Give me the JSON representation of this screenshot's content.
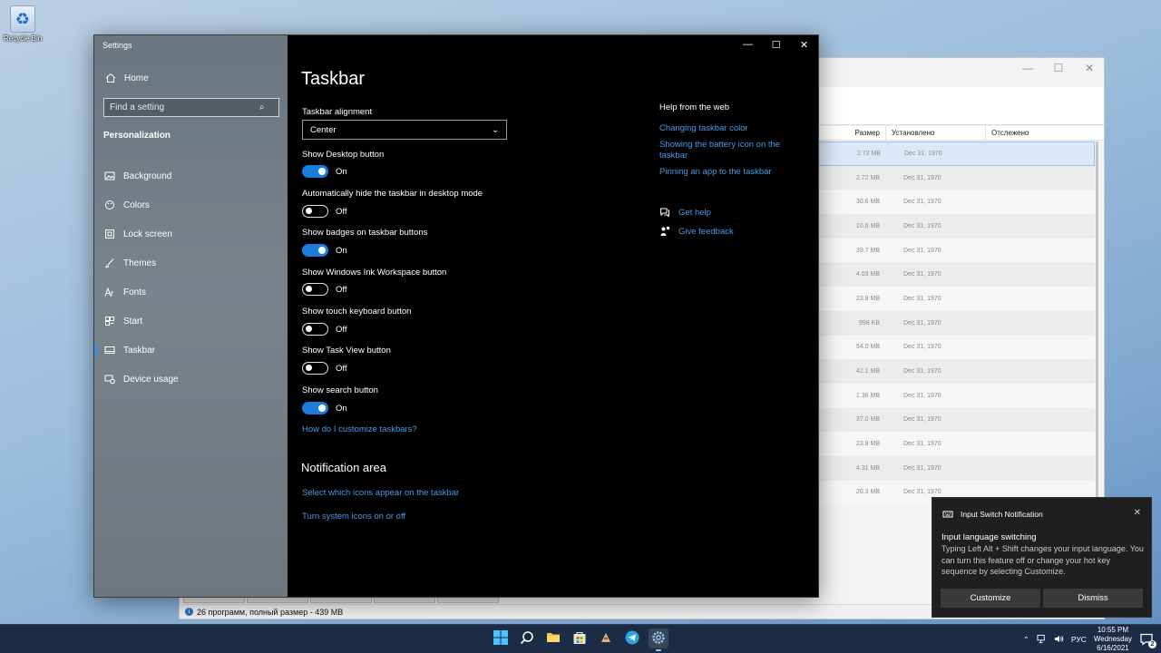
{
  "desktop": {
    "recycle_bin_label": "Recycle Bin"
  },
  "background_window": {
    "columns": [
      "Размер",
      "Установлено",
      "Отслежено"
    ],
    "rows": [
      {
        "size": "2.72 MB",
        "installed": "Dec 31, 1970"
      },
      {
        "size": "2.72 MB",
        "installed": "Dec 31, 1970"
      },
      {
        "size": "30.6 MB",
        "installed": "Dec 31, 1970"
      },
      {
        "size": "10.6 MB",
        "installed": "Dec 31, 1970"
      },
      {
        "size": "39.7 MB",
        "installed": "Dec 31, 1970"
      },
      {
        "size": "4.03 MB",
        "installed": "Dec 31, 1970"
      },
      {
        "size": "23.8 MB",
        "installed": "Dec 31, 1970"
      },
      {
        "size": "998 KB",
        "installed": "Dec 31, 1970"
      },
      {
        "size": "54.0 MB",
        "installed": "Dec 31, 1970"
      },
      {
        "size": "42.1 MB",
        "installed": "Dec 31, 1970"
      },
      {
        "size": "1.36 MB",
        "installed": "Dec 31, 1970"
      },
      {
        "size": "37.0 MB",
        "installed": "Dec 31, 1970"
      },
      {
        "size": "23.8 MB",
        "installed": "Dec 31, 1970"
      },
      {
        "size": "4.31 MB",
        "installed": "Dec 31, 1970"
      },
      {
        "size": "26.3 MB",
        "installed": "Dec 31, 1970"
      }
    ],
    "status_text": "26 программ, полный размер - 439 MB"
  },
  "settings": {
    "app_title": "Settings",
    "home_label": "Home",
    "search_placeholder": "Find a setting",
    "section_label": "Personalization",
    "nav": [
      {
        "label": "Background",
        "icon": "image-icon"
      },
      {
        "label": "Colors",
        "icon": "palette-icon"
      },
      {
        "label": "Lock screen",
        "icon": "lock-screen-icon"
      },
      {
        "label": "Themes",
        "icon": "brush-icon"
      },
      {
        "label": "Fonts",
        "icon": "font-icon"
      },
      {
        "label": "Start",
        "icon": "start-grid-icon"
      },
      {
        "label": "Taskbar",
        "icon": "taskbar-icon",
        "active": true
      },
      {
        "label": "Device usage",
        "icon": "device-usage-icon"
      }
    ],
    "page_title": "Taskbar",
    "alignment": {
      "label": "Taskbar alignment",
      "value": "Center"
    },
    "toggles": [
      {
        "label": "Show Desktop button",
        "state": "On",
        "on": true
      },
      {
        "label": "Automatically hide the taskbar in desktop mode",
        "state": "Off",
        "on": false
      },
      {
        "label": "Show badges on taskbar buttons",
        "state": "On",
        "on": true
      },
      {
        "label": "Show Windows Ink Workspace button",
        "state": "Off",
        "on": false
      },
      {
        "label": "Show touch keyboard button",
        "state": "Off",
        "on": false
      },
      {
        "label": "Show Task View button",
        "state": "Off",
        "on": false
      },
      {
        "label": "Show search button",
        "state": "On",
        "on": true
      }
    ],
    "customize_link": "How do I customize taskbars?",
    "notification_area": {
      "title": "Notification area",
      "links": [
        "Select which icons appear on the taskbar",
        "Turn system icons on or off"
      ]
    },
    "help": {
      "title": "Help from the web",
      "links": [
        "Changing taskbar color",
        "Showing the battery icon on the taskbar",
        "Pinning an app to the taskbar"
      ],
      "get_help": "Get help",
      "give_feedback": "Give feedback"
    }
  },
  "toast": {
    "app_name": "Input Switch Notification",
    "title": "Input language switching",
    "body": "Typing Left Alt + Shift changes your input language. You can turn this feature off or change your hot key sequence by selecting Customize.",
    "customize_label": "Customize",
    "dismiss_label": "Dismiss"
  },
  "taskbar": {
    "language": "РУС",
    "time": "10:55 PM",
    "day": "Wednesday",
    "date": "6/16/2021",
    "notification_count": "2",
    "accent": "#1a7ddd"
  }
}
